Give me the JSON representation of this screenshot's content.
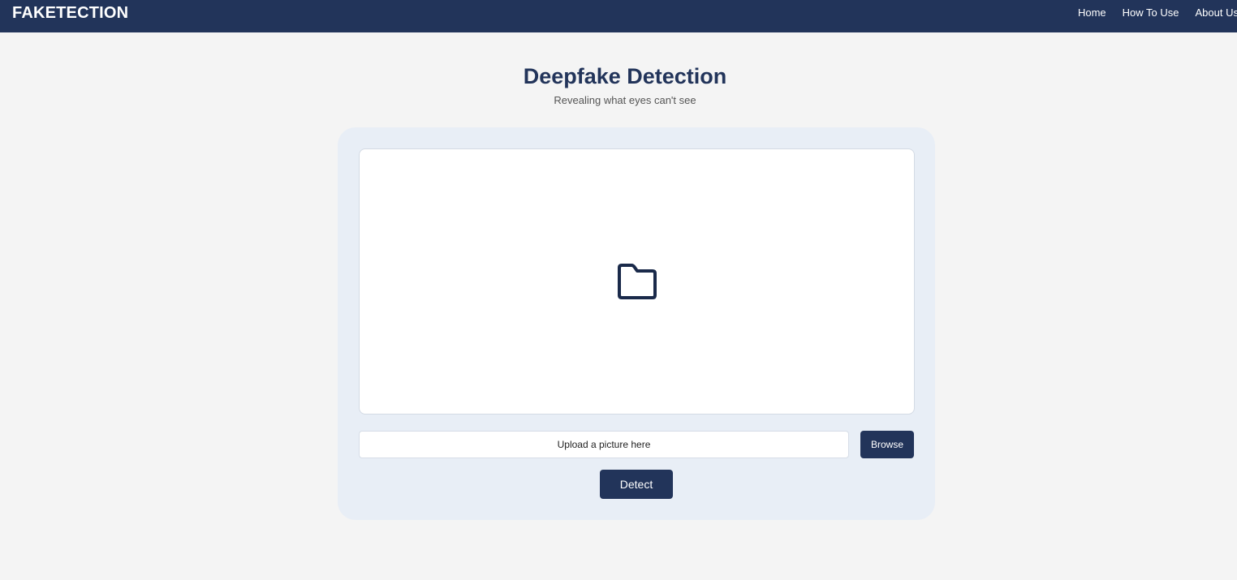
{
  "navbar": {
    "brand": "FAKETECTION",
    "links": [
      {
        "label": "Home"
      },
      {
        "label": "How To Use"
      },
      {
        "label": "About Us"
      }
    ]
  },
  "header": {
    "title": "Deepfake Detection",
    "subtitle": "Revealing what eyes can't see"
  },
  "upload": {
    "dropzone_icon": "folder-icon",
    "placeholder": "Upload a picture here",
    "browse_label": "Browse",
    "detect_label": "Detect"
  },
  "colors": {
    "primary": "#22345a",
    "page_background": "#f4f4f4",
    "card_background": "#e8eef6"
  }
}
